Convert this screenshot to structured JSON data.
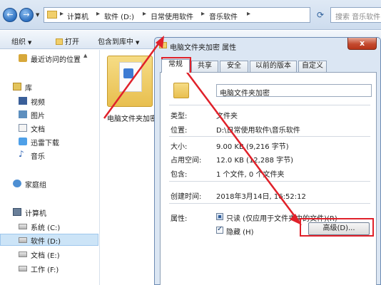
{
  "explorer": {
    "breadcrumbs": [
      "计算机",
      "软件 (D:)",
      "日常使用软件",
      "音乐软件"
    ],
    "search_placeholder": "搜索 音乐软件",
    "toolbar": {
      "organize": "组织",
      "open": "打开",
      "include_in_library": "包含到库中"
    },
    "sidebar": {
      "recent": "最近访问的位置",
      "libraries": "库",
      "videos": "视频",
      "pictures": "图片",
      "documents": "文档",
      "thunder": "迅雷下载",
      "music": "音乐",
      "homegroup": "家庭组",
      "computer": "计算机",
      "drive_c": "系统 (C:)",
      "drive_d": "软件 (D:)",
      "drive_e": "文档 (E:)",
      "drive_f": "工作 (F:)"
    },
    "file": {
      "name": "电脑文件夹加密"
    }
  },
  "dialog": {
    "title": "电脑文件夹加密 属性",
    "close": "x",
    "tabs": [
      "常规",
      "共享",
      "安全",
      "以前的版本",
      "自定义"
    ],
    "active_tab": "常规",
    "name": "电脑文件夹加密",
    "properties": {
      "type_label": "类型:",
      "type_value": "文件夹",
      "location_label": "位置:",
      "location_value": "D:\\日常使用软件\\音乐软件",
      "size_label": "大小:",
      "size_value": "9.00 KB (9,216 字节)",
      "disk_size_label": "占用空间:",
      "disk_size_value": "12.0 KB (12,288 字节)",
      "contains_label": "包含:",
      "contains_value": "1 个文件, 0 个文件夹",
      "created_label": "创建时间:",
      "created_value": "2018年3月14日, 16:52:12",
      "attributes_label": "属性:",
      "readonly_label": "只读 (仅应用于文件夹中的文件)(R)",
      "readonly_state": "partial",
      "hidden_label": "隐藏 (H)",
      "hidden_checked": true
    },
    "advanced_button": "高级(D)..."
  },
  "annotations": {
    "color": "#e0212a"
  }
}
